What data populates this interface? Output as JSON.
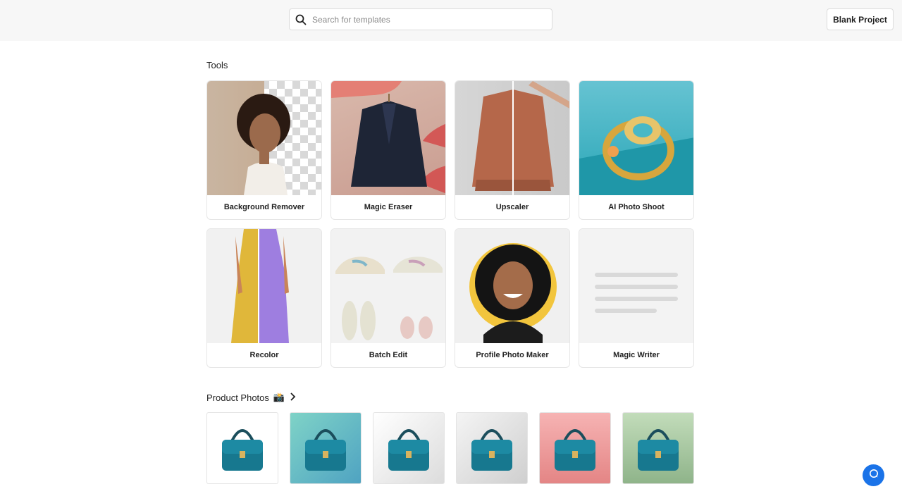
{
  "header": {
    "search": {
      "placeholder": "Search for templates",
      "value": ""
    },
    "blank_project_label": "Blank Project"
  },
  "tools": {
    "title": "Tools",
    "items": [
      {
        "label": "Background Remover",
        "icon": "woman-portrait-image"
      },
      {
        "label": "Magic Eraser",
        "icon": "jacket-image"
      },
      {
        "label": "Upscaler",
        "icon": "bomber-jacket-image"
      },
      {
        "label": "AI Photo Shoot",
        "icon": "ring-image"
      },
      {
        "label": "Recolor",
        "icon": "dress-image"
      },
      {
        "label": "Batch Edit",
        "icon": "sneakers-image"
      },
      {
        "label": "Profile Photo Maker",
        "icon": "man-portrait-image"
      },
      {
        "label": "Magic Writer",
        "icon": "text-lines-image"
      }
    ]
  },
  "product_photos": {
    "title": "Product Photos",
    "emoji": "📸",
    "items": [
      {
        "name": "teal-handbag",
        "background": "#ffffff"
      },
      {
        "name": "teal-handbag",
        "background": "#7fd3c7"
      },
      {
        "name": "teal-handbag",
        "background": "#efefef"
      },
      {
        "name": "teal-handbag",
        "background": "#e4e4e4"
      },
      {
        "name": "teal-handbag",
        "background": "#f3a9a9"
      },
      {
        "name": "teal-handbag",
        "background": "#a8c9a0"
      }
    ]
  },
  "colors": {
    "accent": "#1a73e8",
    "topbar": "#f7f7f7"
  }
}
